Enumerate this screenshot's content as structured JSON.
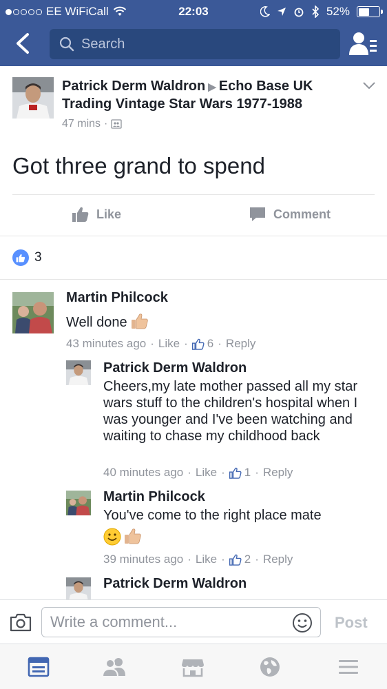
{
  "status_bar": {
    "carrier": "EE WiFiCall",
    "time": "22:03",
    "battery": "52%",
    "battery_level": 0.52
  },
  "header": {
    "search_placeholder": "Search"
  },
  "post": {
    "author": "Patrick Derm Waldron",
    "group": "Echo Base UK Trading Vintage Star Wars 1977-1988",
    "time": "47 mins",
    "text": "Got three grand to spend",
    "like_label": "Like",
    "comment_label": "Comment",
    "reaction_count": "3"
  },
  "comments": [
    {
      "name": "Martin Philcock",
      "text": "Well done",
      "time": "43 minutes ago",
      "like_label": "Like",
      "like_count": "6",
      "reply_label": "Reply"
    },
    {
      "name": "Patrick Derm Waldron",
      "text": "Cheers,my late mother passed all my star wars stuff to the children's hospital when I was younger and I've been watching and waiting to chase my childhood back",
      "time": "40 minutes ago",
      "like_label": "Like",
      "like_count": "1",
      "reply_label": "Reply"
    },
    {
      "name": "Martin Philcock",
      "text": "You've come to the right place mate",
      "time": "39 minutes ago",
      "like_label": "Like",
      "like_count": "2",
      "reply_label": "Reply"
    },
    {
      "name": "Patrick Derm Waldron"
    }
  ],
  "composer": {
    "placeholder": "Write a comment...",
    "post_label": "Post"
  },
  "colors": {
    "brand_blue": "#3b5998",
    "search_bg": "#29487d",
    "like_blue": "#5890ff",
    "meta_gray": "#90949c"
  }
}
